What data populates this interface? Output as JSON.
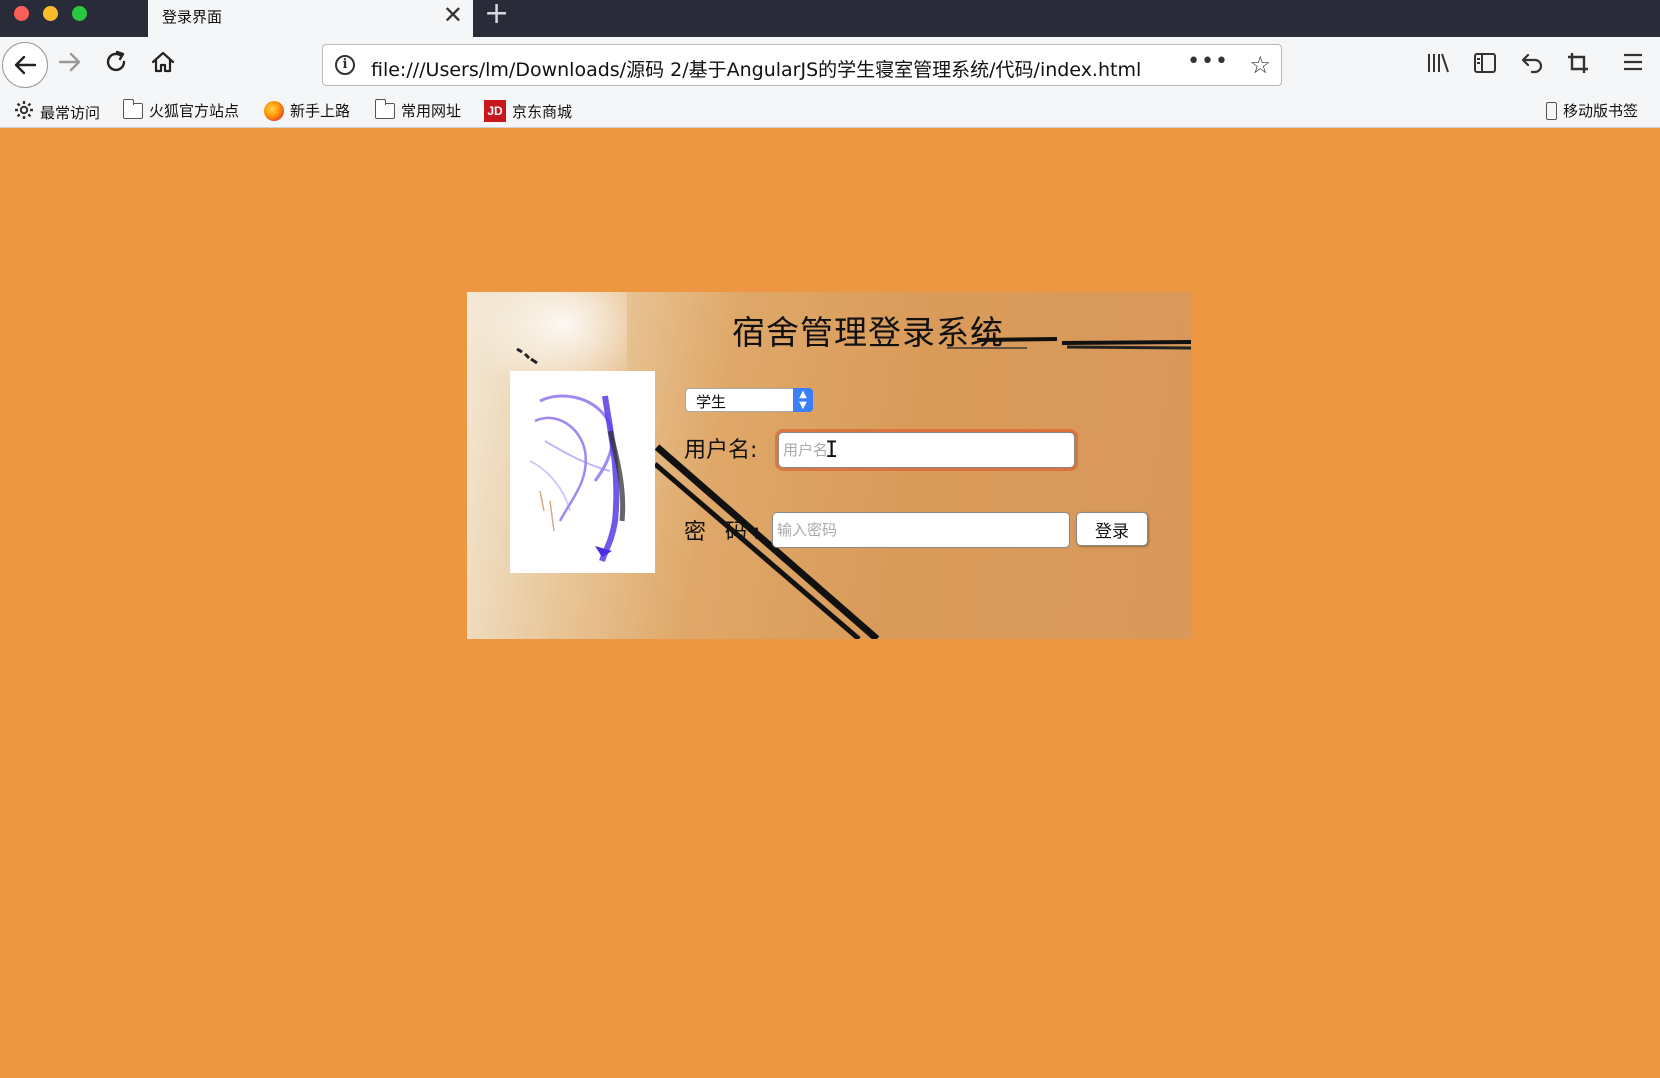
{
  "browser": {
    "tab": {
      "title": "登录界面"
    },
    "url": "file:///Users/lm/Downloads/源码 2/基于AngularJS的学生寝室管理系统/代码/index.html",
    "bookmarks": [
      {
        "icon": "gear-icon",
        "label": "最常访问"
      },
      {
        "icon": "folder-icon",
        "label": "火狐官方站点"
      },
      {
        "icon": "firefox-icon",
        "label": "新手上路"
      },
      {
        "icon": "folder-icon",
        "label": "常用网址"
      },
      {
        "icon": "jd-icon",
        "icon_text": "JD",
        "label": "京东商城"
      }
    ],
    "mobile_bookmarks": "移动版书签"
  },
  "login": {
    "title": "宿舍管理登录系统",
    "role_selected": "学生",
    "username_label": "用户名:",
    "username_placeholder": "用户名",
    "password_label": "密 码:",
    "password_placeholder": "输入密码",
    "login_button": "登录"
  },
  "colors": {
    "page_background": "#ed9743",
    "tab_strip": "#2a2b38",
    "select_arrow": "#3a7ff6"
  }
}
